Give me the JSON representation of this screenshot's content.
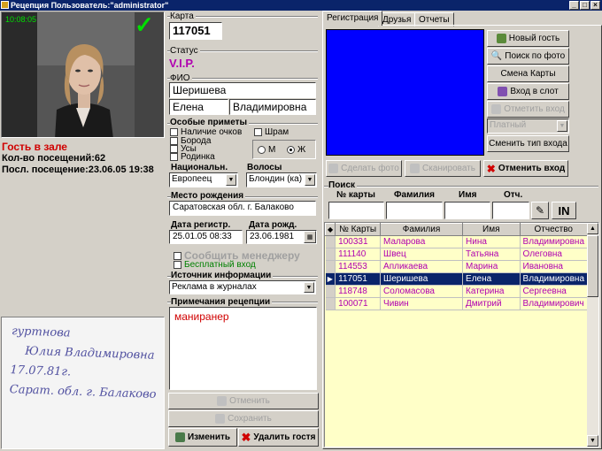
{
  "window": {
    "title": "Рецепция Пользователь:\"administrator\"",
    "min": "_",
    "max": "□",
    "close": "×"
  },
  "photo": {
    "timestamp": "10:08:05",
    "check": "✓"
  },
  "guest": {
    "status": "Гость в зале",
    "visits": "Кол-во посещений:62",
    "last_visit": "Посл. посещение:23.06.05 19:38"
  },
  "card": {
    "label": "Карта",
    "value": "117051"
  },
  "status": {
    "label": "Статус",
    "value": "V.I.P."
  },
  "fio": {
    "label": "ФИО",
    "last": "Шеришева",
    "first": "Елена",
    "middle": "Владимировна"
  },
  "features": {
    "label": "Особые приметы",
    "items": [
      "Наличие очков",
      "Шрам",
      "Борода",
      "Усы",
      "Родинка"
    ],
    "gender_m": "М",
    "gender_f": "Ж"
  },
  "nationality": {
    "label": "Национальн.",
    "value": "Европеец"
  },
  "hair": {
    "label": "Волосы",
    "value": "Блондин (ка)"
  },
  "birthplace": {
    "label": "Место рождения",
    "value": "Саратовская обл. г. Балаково"
  },
  "reg_date": {
    "label": "Дата регистр.",
    "value": "25.01.05 08:33"
  },
  "birth_date": {
    "label": "Дата рожд.",
    "value": "23.06.1981"
  },
  "notify": {
    "label": "Сообщить менеджеру"
  },
  "free_entry": {
    "label": "Бесплатный вход"
  },
  "source": {
    "label": "Источник информации",
    "value": "Реклама в журналах"
  },
  "notes": {
    "label": "Примечания рецепции",
    "value": "маниранер"
  },
  "signature": {
    "lines": [
      "гуртнова",
      "Юлия Владимировна",
      "17.07.81г.",
      "Сарат. обл. г. Балаково"
    ]
  },
  "left_buttons": {
    "cancel": "Отменить",
    "save": "Сохранить",
    "edit": "Изменить",
    "delete": "Удалить гостя"
  },
  "tabs": [
    "Регистрация",
    "Друзья",
    "Отчеты"
  ],
  "reg_buttons": {
    "new_guest": "Новый гость",
    "photo_search": "Поиск по фото",
    "change_card": "Смена Карты",
    "enter_slot": "Вход в слот",
    "cancel_entry_dis": "Отметить вход",
    "entry_type": "Платный",
    "change_entry_type": "Сменить тип входа",
    "take_photo": "Сделать фото",
    "scan": "Сканировать",
    "cancel_entry": "Отменить вход"
  },
  "search": {
    "label": "Поиск",
    "col_card": "№ карты",
    "col_last": "Фамилия",
    "col_first": "Имя",
    "col_middle": "Отч.",
    "in_label": "IN"
  },
  "table": {
    "headers": [
      "№ Карты",
      "Фамилия",
      "Имя",
      "Отчество"
    ],
    "rows": [
      [
        "100331",
        "Маларова",
        "Нина",
        "Владимировна"
      ],
      [
        "111140",
        "Швец",
        "Татьяна",
        "Олеговна"
      ],
      [
        "114553",
        "Апликаева",
        "Марина",
        "Ивановна"
      ],
      [
        "117051",
        "Шеришева",
        "Елена",
        "Владимировна"
      ],
      [
        "118748",
        "Соломасова",
        "Катерина",
        "Сергеевна"
      ],
      [
        "100071",
        "Чивин",
        "Дмитрий",
        "Владимирович"
      ]
    ],
    "selected_index": 3
  },
  "colors": {
    "title_bg": "#0a246a",
    "status_red": "#d00000",
    "vip_purple": "#b000b0",
    "camera_blue": "#0000ff",
    "grid_bg": "#ffffc8"
  }
}
